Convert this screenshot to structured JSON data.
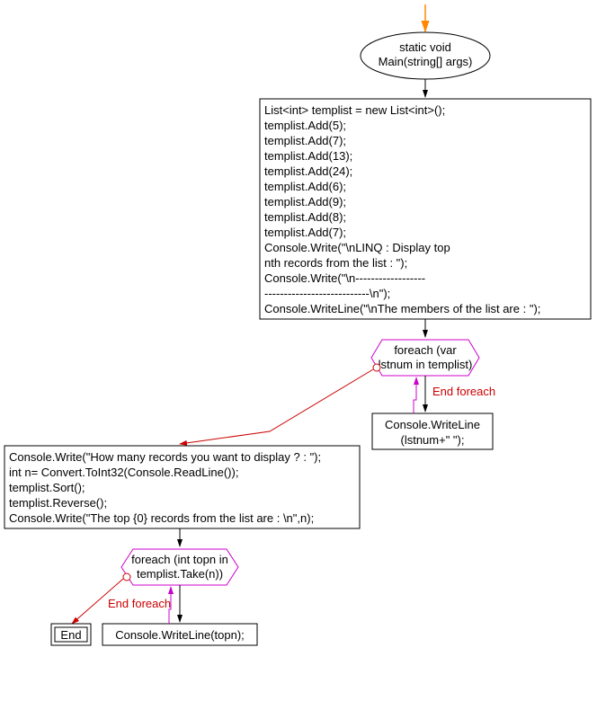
{
  "start": {
    "line1": "static void",
    "line2": "Main(string[] args)"
  },
  "block1": {
    "lines": [
      "List<int> templist = new List<int>();",
      "templist.Add(5);",
      "templist.Add(7);",
      "templist.Add(13);",
      "templist.Add(24);",
      "templist.Add(6);",
      "templist.Add(9);",
      "templist.Add(8);",
      "templist.Add(7);",
      "Console.Write(\"\\nLINQ : Display top",
      "nth  records from the list : \");",
      "Console.Write(\"\\n------------------",
      "---------------------------\\n\");",
      "Console.WriteLine(\"\\nThe members of the list are : \");"
    ]
  },
  "foreach1": {
    "line1": "foreach (var",
    "line2": "lstnum in templist)"
  },
  "body1": {
    "line1": "Console.WriteLine",
    "line2": "(lstnum+\" \");"
  },
  "end_foreach1": "End foreach",
  "block2": {
    "lines": [
      "Console.Write(\"How many records you want to display ? : \");",
      "int n= Convert.ToInt32(Console.ReadLine());",
      "templist.Sort();",
      "templist.Reverse();",
      "Console.Write(\"The top {0} records from the list are : \\n\",n);"
    ]
  },
  "foreach2": {
    "line1": "foreach (int topn in",
    "line2": "templist.Take(n))"
  },
  "body2": {
    "line1": "Console.WriteLine(topn);"
  },
  "end_foreach2": "End foreach",
  "end": "End"
}
